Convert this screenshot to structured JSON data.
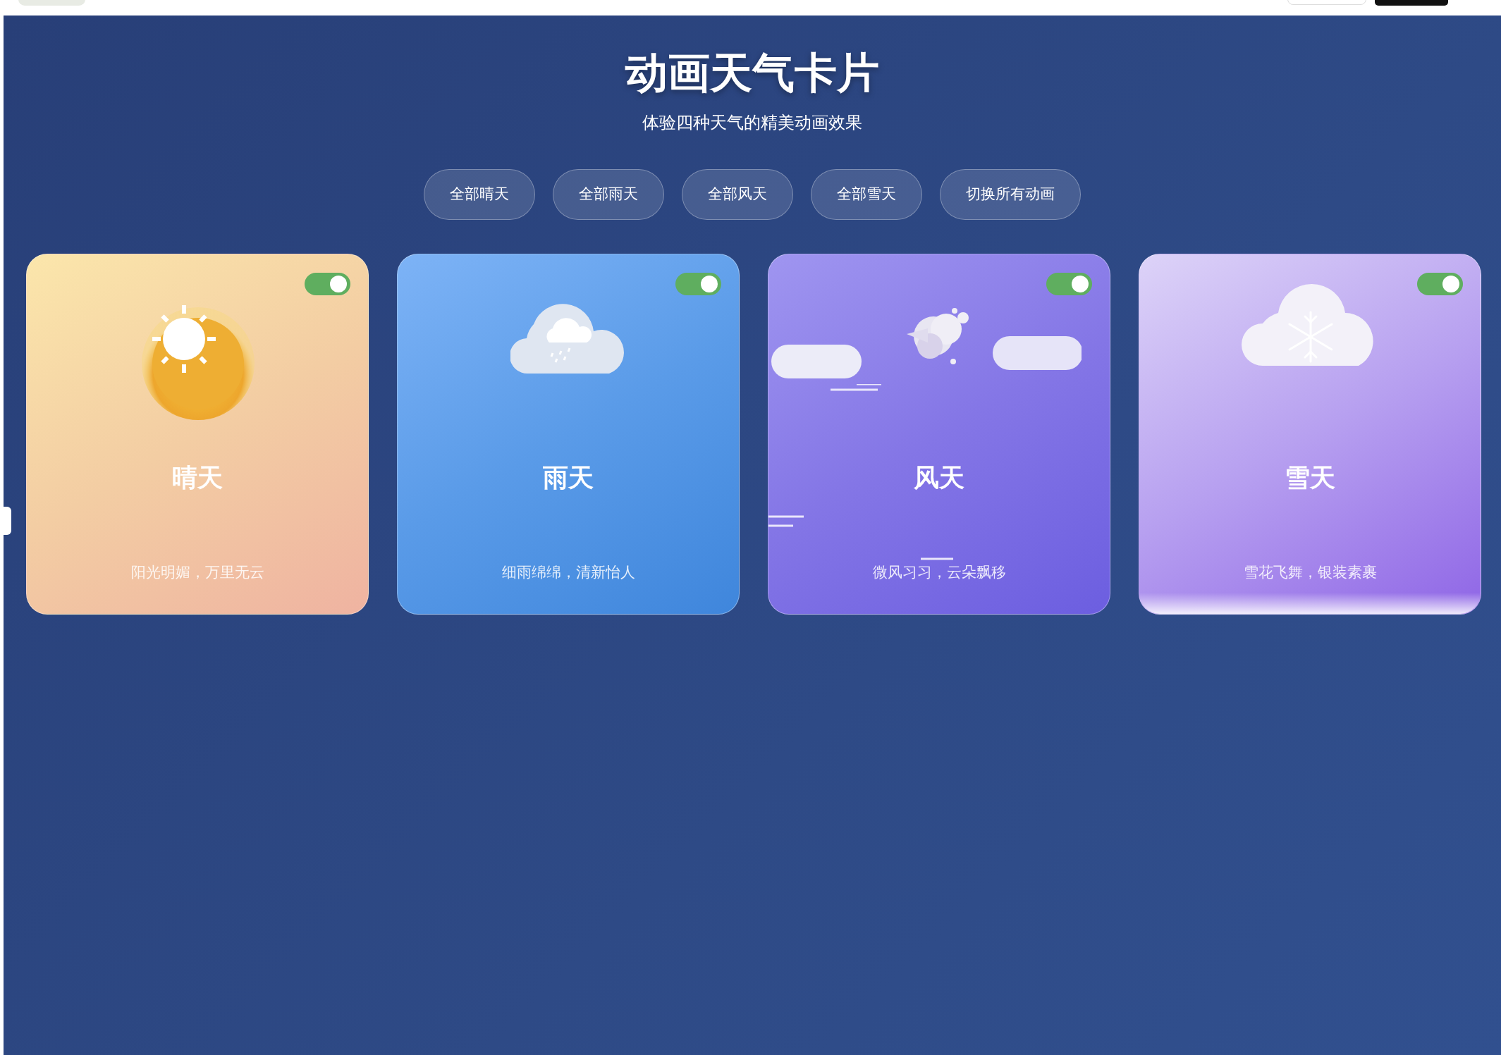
{
  "title": "动画天气卡片",
  "subtitle": "体验四种天气的精美动画效果",
  "buttons": [
    "全部晴天",
    "全部雨天",
    "全部风天",
    "全部雪天",
    "切换所有动画"
  ],
  "cards": [
    {
      "kind": "sunny",
      "title": "晴天",
      "description": "阳光明媚，万里无云",
      "on": true
    },
    {
      "kind": "rainy",
      "title": "雨天",
      "description": "细雨绵绵，清新怡人",
      "on": true
    },
    {
      "kind": "windy",
      "title": "风天",
      "description": "微风习习，云朵飘移",
      "on": true
    },
    {
      "kind": "snowy",
      "title": "雪天",
      "description": "雪花飞舞，银装素裹",
      "on": true
    }
  ]
}
